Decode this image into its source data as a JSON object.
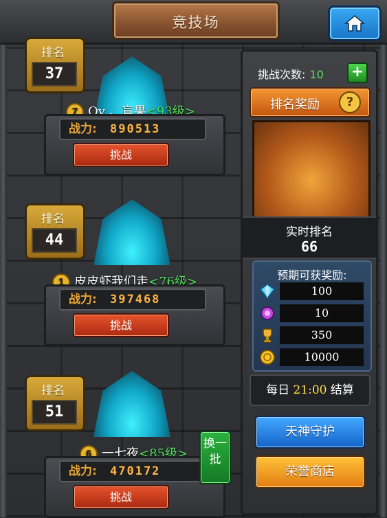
{
  "header": {
    "title": "竞技场",
    "home_icon": "home-icon"
  },
  "players": [
    {
      "rank_label": "排名",
      "rank": "37",
      "vip": "7",
      "name": "Qy 、盲果",
      "level": "<93级>",
      "power_label": "战力:",
      "power": "890513",
      "challenge_label": "挑战"
    },
    {
      "rank_label": "排名",
      "rank": "44",
      "vip": "1",
      "name": "皮皮虾我们走",
      "level": "<76级>",
      "power_label": "战力:",
      "power": "397468",
      "challenge_label": "挑战"
    },
    {
      "rank_label": "排名",
      "rank": "51",
      "vip": "6",
      "name": "一七夜",
      "level": "<85级>",
      "power_label": "战力:",
      "power": "470172",
      "challenge_label": "挑战"
    }
  ],
  "swap_button": {
    "label": "换一批"
  },
  "panel": {
    "challenge_count_label": "挑战次数:",
    "challenge_count": "10",
    "plus": "+",
    "reward_button": "排名奖励",
    "help": "?",
    "current_rank_label": "实时排名",
    "current_rank": "66",
    "expected_rewards_title": "预期可获奖励:",
    "rewards": [
      {
        "icon": "diamond-icon",
        "value": "100"
      },
      {
        "icon": "purple-gem-icon",
        "value": "10"
      },
      {
        "icon": "trophy-icon",
        "value": "350"
      },
      {
        "icon": "gold-coin-icon",
        "value": "10000"
      }
    ],
    "settle_prefix": "每日",
    "settle_time": "21:00",
    "settle_suffix": "结算",
    "tianshen_button": "天神守护",
    "honor_button": "荣誉商店"
  },
  "colors": {
    "level_green": "#53e15a",
    "power_orange": "#ffb545",
    "settle_yellow": "#ffe14a"
  }
}
